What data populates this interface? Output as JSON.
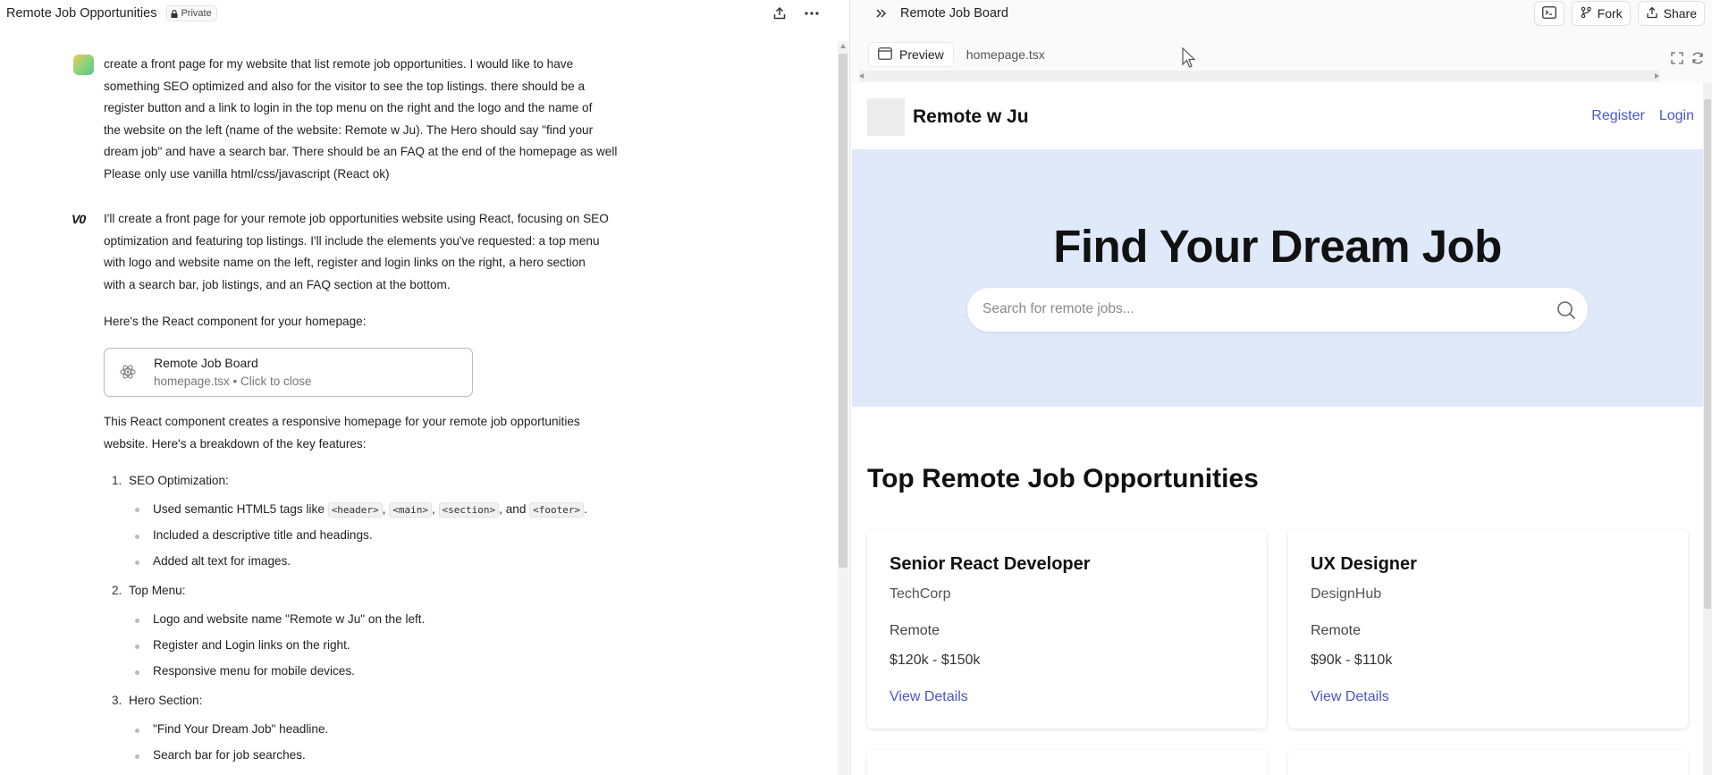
{
  "left": {
    "chat_title": "Remote Job Opportunities",
    "private_label": "Private",
    "user_message": [
      "create a front page for my website that list remote job opportunities. I would like to have",
      "something SEO optimized and also for the visitor to see the top listings. there should be a",
      "register button and a link to login in the top menu on the right and the logo and the name of",
      "the website on the left (name of the website: Remote w Ju). The Hero should say \"find your",
      "dream job\" and have a search bar. There should be an FAQ at the end of the homepage as well",
      "Please only use vanilla html/css/javascript (React ok)"
    ],
    "assistant_logo": "V0",
    "assistant_intro": [
      "I'll create a front page for your remote job opportunities website using React, focusing on SEO",
      "optimization and featuring top listings. I'll include the elements you've requested: a top menu",
      "with logo and website name on the left, register and login links on the right, a hero section",
      "with a search bar, job listings, and an FAQ section at the bottom."
    ],
    "component_intro": "Here's the React component for your homepage:",
    "artifact": {
      "title": "Remote Job Board",
      "subtitle": "homepage.tsx • Click to close"
    },
    "summary": [
      "This React component creates a responsive homepage for your remote job opportunities",
      "website. Here's a breakdown of the key features:"
    ],
    "features": [
      {
        "num": "1.",
        "label": "SEO Optimization:",
        "bullets_prefix": "Used semantic HTML5 tags like",
        "tags": [
          "<header>",
          "<main>",
          "<section>",
          "<footer>"
        ],
        "and_text": ", and",
        "bullets": [
          "Included a descriptive title and headings.",
          "Added alt text for images."
        ]
      },
      {
        "num": "2.",
        "label": "Top Menu:",
        "bullets": [
          "Logo and website name \"Remote w Ju\" on the left.",
          "Register and Login links on the right.",
          "Responsive menu for mobile devices."
        ]
      },
      {
        "num": "3.",
        "label": "Hero Section:",
        "bullets": [
          "\"Find Your Dream Job\" headline.",
          "Search bar for job searches."
        ]
      }
    ]
  },
  "right": {
    "panel_title": "Remote Job Board",
    "fork_label": "Fork",
    "share_label": "Share",
    "tab_preview": "Preview",
    "tab_code": "homepage.tsx",
    "site": {
      "name": "Remote w Ju",
      "register": "Register",
      "login": "Login",
      "hero_title": "Find Your Dream Job",
      "search_placeholder": "Search for remote jobs...",
      "section_title": "Top Remote Job Opportunities",
      "jobs": [
        {
          "title": "Senior React Developer",
          "company": "TechCorp",
          "location": "Remote",
          "salary": "$120k - $150k",
          "link": "View Details"
        },
        {
          "title": "UX Designer",
          "company": "DesignHub",
          "location": "Remote",
          "salary": "$90k - $110k",
          "link": "View Details"
        }
      ]
    }
  },
  "colors": {
    "accent_link": "#4856c7",
    "hero_bg": "#dfe9f9"
  }
}
